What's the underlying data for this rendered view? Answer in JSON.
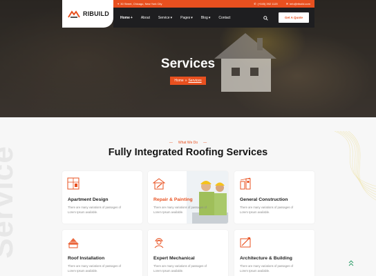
{
  "brand": {
    "name": "RIBUILD",
    "accent": "#e8501f"
  },
  "topbar": {
    "address": "30 Street, Chicago, New York City",
    "phone": "(+045) 392 1120",
    "email": "info@ribuild.com"
  },
  "nav": {
    "items": [
      {
        "label": "Home",
        "caret": true,
        "active": true
      },
      {
        "label": "About",
        "caret": false
      },
      {
        "label": "Service",
        "caret": true
      },
      {
        "label": "Pages",
        "caret": true
      },
      {
        "label": "Blog",
        "caret": true
      },
      {
        "label": "Contact",
        "caret": false
      }
    ],
    "cta": "Get A Quote"
  },
  "hero": {
    "title": "Services",
    "breadcrumb": {
      "home": "Home",
      "separator": "»",
      "current": "Services"
    }
  },
  "section": {
    "watermark": "Service",
    "eyebrow": "What We Do",
    "heading": "Fully Integrated Roofing Services"
  },
  "services": [
    {
      "title": "Apartment Design",
      "desc": "There are many variations of passages of Lorem Ipsum available.",
      "icon": "apartment-icon"
    },
    {
      "title": "Repair & Painting",
      "desc": "There are many variations of passages of Lorem Ipsum available.",
      "icon": "repair-icon"
    },
    {
      "title": "General Construction",
      "desc": "There are many variations of passages of Lorem Ipsum available.",
      "icon": "construction-icon"
    },
    {
      "title": "Roof Installation",
      "desc": "There are many variations of passages of Lorem Ipsum available.",
      "icon": "roof-icon"
    },
    {
      "title": "Expert Mechanical",
      "desc": "There are many variations of passages of Lorem Ipsum available.",
      "icon": "mechanic-icon"
    },
    {
      "title": "Architecture & Building",
      "desc": "There are many variations of passages of Lorem Ipsum available.",
      "icon": "architecture-icon"
    }
  ]
}
